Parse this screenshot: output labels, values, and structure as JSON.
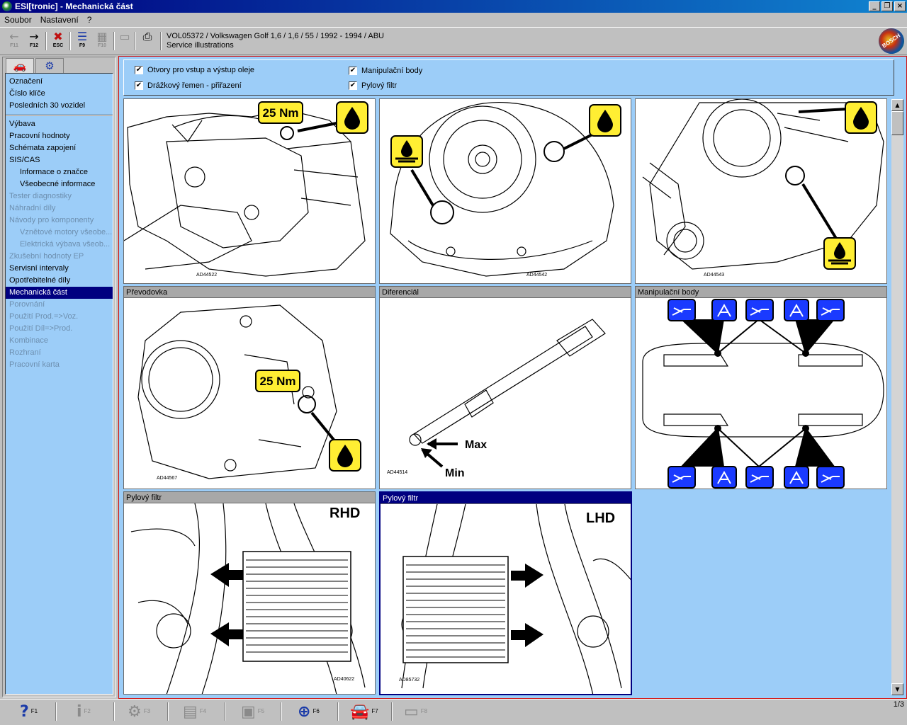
{
  "window": {
    "title": "ESI[tronic] - Mechanická část"
  },
  "menu": [
    "Soubor",
    "Nastavení",
    "?"
  ],
  "toolbar": {
    "buttons": [
      {
        "icon": "arrow-left-icon",
        "glyph": "←",
        "key": "F11"
      },
      {
        "icon": "arrow-right-icon",
        "glyph": "→",
        "key": "F12"
      },
      {
        "icon": "exit-icon",
        "glyph": "✖",
        "key": "ESC"
      },
      {
        "icon": "document-icon",
        "glyph": "☰",
        "key": "F9"
      },
      {
        "icon": "grid-icon",
        "glyph": "▦",
        "key": "F10"
      },
      {
        "icon": "page-icon",
        "glyph": "▭",
        "key": ""
      },
      {
        "icon": "print-icon",
        "glyph": "⎙",
        "key": ""
      }
    ],
    "vehicle_line": "VOL05372 / Volkswagen Golf 1,6  / 1,6 / 55 / 1992 - 1994 / ABU",
    "context_line": "Service illustrations",
    "brand": "BOSCH"
  },
  "sidebar": {
    "tabs": [
      {
        "icon": "car-icon",
        "glyph": "🚗"
      },
      {
        "icon": "engine-icon",
        "glyph": "⚙"
      }
    ],
    "group1": [
      "Označení",
      "Číslo klíče",
      "Posledních 30 vozidel"
    ],
    "group2": [
      {
        "label": "Výbava",
        "state": "normal"
      },
      {
        "label": "Pracovní hodnoty",
        "state": "normal"
      },
      {
        "label": "Schémata zapojení",
        "state": "normal"
      },
      {
        "label": "SIS/CAS",
        "state": "normal"
      },
      {
        "label": "Informace o značce",
        "state": "sub"
      },
      {
        "label": "Všeobecné informace",
        "state": "sub"
      },
      {
        "label": "Tester diagnostiky",
        "state": "disabled"
      },
      {
        "label": "Náhradní díly",
        "state": "disabled"
      },
      {
        "label": "Návody pro komponenty",
        "state": "disabled"
      },
      {
        "label": "Vznětové motory všeobe...",
        "state": "sub-disabled"
      },
      {
        "label": "Elektrická výbava všeob...",
        "state": "sub-disabled"
      },
      {
        "label": "Zkušební hodnoty EP",
        "state": "disabled"
      },
      {
        "label": "Servisní intervaly",
        "state": "normal"
      },
      {
        "label": "Opotřebitelné díly",
        "state": "normal"
      },
      {
        "label": "Mechanická část",
        "state": "selected"
      },
      {
        "label": "Porovnání",
        "state": "disabled"
      },
      {
        "label": "Použití Prod.=>Voz.",
        "state": "disabled"
      },
      {
        "label": "Použití Díl=>Prod.",
        "state": "disabled"
      },
      {
        "label": "Kombinace",
        "state": "disabled"
      },
      {
        "label": "Rozhraní",
        "state": "disabled"
      },
      {
        "label": "Pracovní karta",
        "state": "disabled"
      }
    ]
  },
  "filters": [
    {
      "label": "Otvory pro vstup a výstup oleje",
      "checked": true
    },
    {
      "label": "Drážkový řemen - přiřazení",
      "checked": true
    },
    {
      "label": "Manipulační body",
      "checked": true
    },
    {
      "label": "Pylový filtr",
      "checked": true
    }
  ],
  "illustrations": {
    "p1": {
      "code": "AD44522",
      "torque": "25 Nm"
    },
    "p2": {
      "code": "AD44542"
    },
    "p3": {
      "code": "AD44543"
    },
    "p4": {
      "title": "Převodovka",
      "code": "AD44567",
      "torque": "25 Nm"
    },
    "p5": {
      "title": "Diferenciál",
      "code": "AD44514",
      "max": "Max",
      "min": "Min"
    },
    "p6": {
      "title": "Manipulační body"
    },
    "p7": {
      "title": "Pylový filtr",
      "code": "AD40622",
      "side": "RHD"
    },
    "p8": {
      "title": "Pylový filtr",
      "code": "AD85732",
      "side": "LHD"
    }
  },
  "bottom": {
    "buttons": [
      {
        "icon": "help-icon",
        "glyph": "?",
        "key": "F1",
        "enabled": true
      },
      {
        "icon": "info-icon",
        "glyph": "i",
        "key": "F2",
        "enabled": false
      },
      {
        "icon": "tools-icon",
        "glyph": "⚙",
        "key": "F3",
        "enabled": false
      },
      {
        "icon": "list-icon",
        "glyph": "▤",
        "key": "F4",
        "enabled": false
      },
      {
        "icon": "parts-icon",
        "glyph": "▣",
        "key": "F5",
        "enabled": false
      },
      {
        "icon": "zoom-icon",
        "glyph": "⊕",
        "key": "F6",
        "enabled": true
      },
      {
        "icon": "car-icon",
        "glyph": "🚘",
        "key": "F7",
        "enabled": true
      },
      {
        "icon": "card-icon",
        "glyph": "▭",
        "key": "F8",
        "enabled": false
      }
    ],
    "page_indicator": "1/3"
  }
}
